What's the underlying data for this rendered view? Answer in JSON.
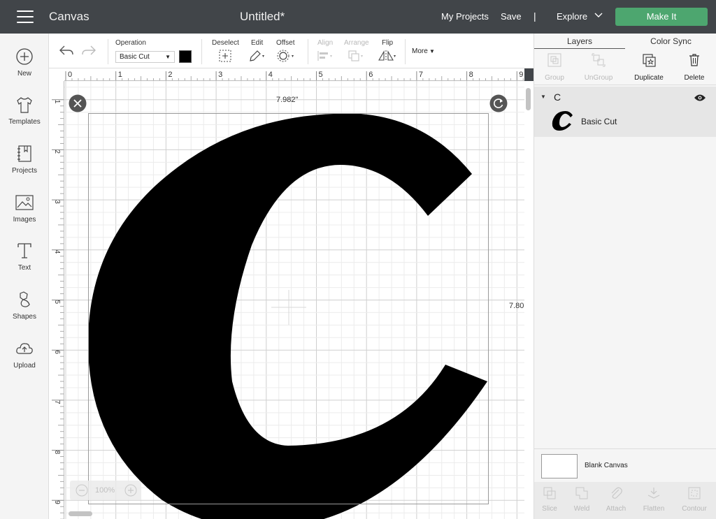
{
  "app": {
    "name": "Canvas",
    "document_title": "Untitled*",
    "nav": {
      "my_projects": "My Projects",
      "save": "Save",
      "separator": "|",
      "explore": "Explore",
      "make_it": "Make It"
    },
    "accent_color": "#4da66f"
  },
  "leftbar": {
    "items": [
      {
        "label": "New",
        "icon": "plus-circle-icon"
      },
      {
        "label": "Templates",
        "icon": "shirt-icon"
      },
      {
        "label": "Projects",
        "icon": "notebook-icon"
      },
      {
        "label": "Images",
        "icon": "image-icon"
      },
      {
        "label": "Text",
        "icon": "text-T-icon"
      },
      {
        "label": "Shapes",
        "icon": "shapes-icon"
      },
      {
        "label": "Upload",
        "icon": "cloud-upload-icon"
      }
    ]
  },
  "toolbar": {
    "operation_label": "Operation",
    "operation_value": "Basic Cut",
    "operation_color": "#000000",
    "deselect": "Deselect",
    "edit": "Edit",
    "offset": "Offset",
    "align": "Align",
    "arrange": "Arrange",
    "flip": "Flip",
    "more": "More"
  },
  "rulers": {
    "top_ticks": [
      "0",
      "1",
      "2",
      "3",
      "4",
      "5",
      "6",
      "7",
      "8",
      "9"
    ],
    "left_ticks": [
      "1",
      "2",
      "3",
      "4",
      "5",
      "6",
      "7",
      "8",
      "9"
    ]
  },
  "canvas": {
    "width_readout": "7.982\"",
    "height_readout": "7.80",
    "zoom": "100%",
    "letter": "C"
  },
  "rightpanel": {
    "tabs": [
      "Layers",
      "Color Sync"
    ],
    "actions": [
      "Group",
      "UnGroup",
      "Duplicate",
      "Delete"
    ],
    "layer_group_name": "C",
    "layer_item_label": "Basic Cut",
    "blank_canvas": "Blank Canvas",
    "bottom_actions": [
      "Slice",
      "Weld",
      "Attach",
      "Flatten",
      "Contour"
    ]
  }
}
